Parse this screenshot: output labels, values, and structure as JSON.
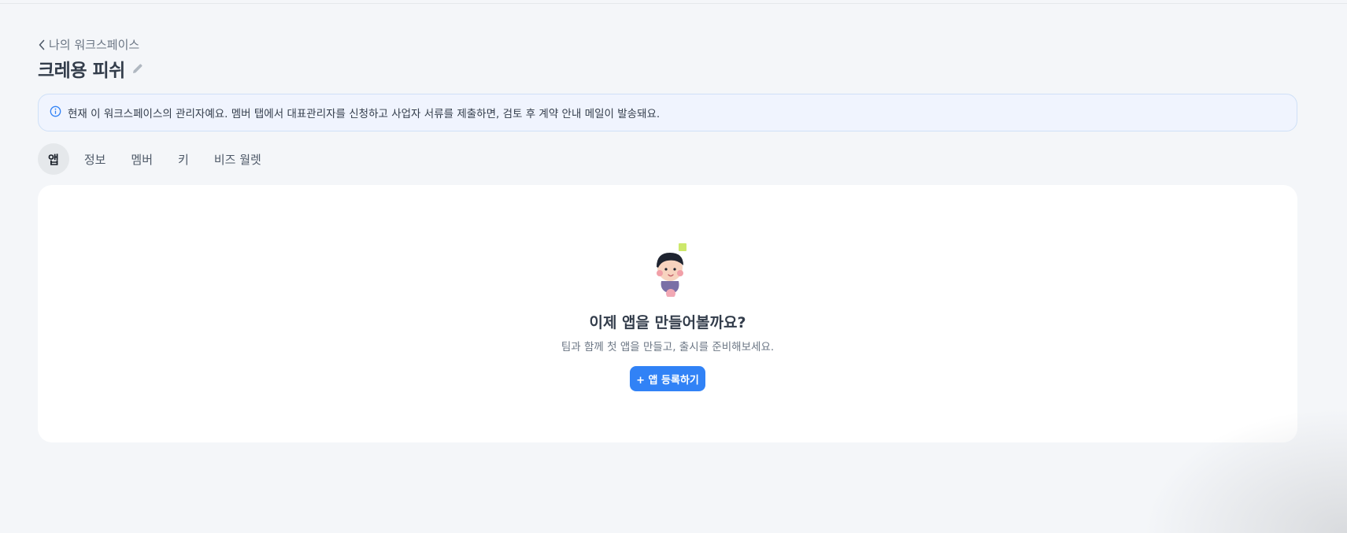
{
  "breadcrumb": {
    "label": "나의 워크스페이스"
  },
  "workspace": {
    "title": "크레용 피쉬"
  },
  "notice": {
    "text": "현재 이 워크스페이스의 관리자예요. 멤버 탭에서 대표관리자를 신청하고 사업자 서류를 제출하면, 검토 후 계약 안내 메일이 발송돼요."
  },
  "tabs": [
    {
      "label": "앱",
      "active": true
    },
    {
      "label": "정보",
      "active": false
    },
    {
      "label": "멤버",
      "active": false
    },
    {
      "label": "키",
      "active": false
    },
    {
      "label": "비즈 월렛",
      "active": false
    }
  ],
  "empty_state": {
    "title": "이제 앱을 만들어볼까요?",
    "description": "팀과 함께 첫 앱을 만들고, 출시를 준비해보세요.",
    "button_label": "+ 앱 등록하기"
  },
  "colors": {
    "accent": "#3182f6",
    "background": "#f4f6f9",
    "notice_bg": "#f0f4fe"
  },
  "icons": [
    "chevron-left-icon",
    "pencil-icon",
    "info-icon"
  ]
}
